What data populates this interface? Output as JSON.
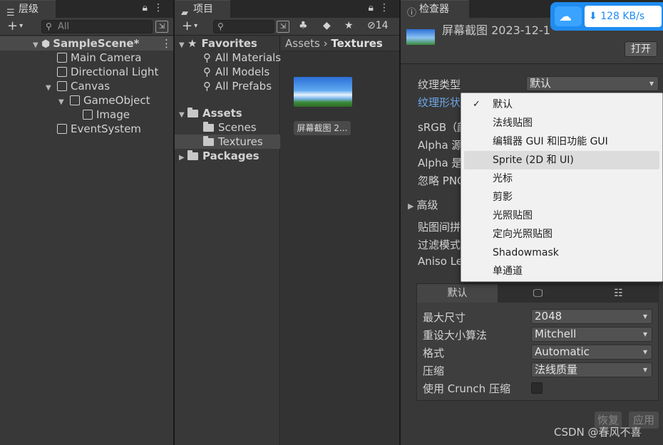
{
  "hierarchy": {
    "tab_label": "层级",
    "search_placeholder": "All",
    "items": [
      {
        "label": "SampleScene*"
      },
      {
        "label": "Main Camera"
      },
      {
        "label": "Directional Light"
      },
      {
        "label": "Canvas"
      },
      {
        "label": "GameObject"
      },
      {
        "label": "Image"
      },
      {
        "label": "EventSystem"
      }
    ]
  },
  "project": {
    "tab_label": "项目",
    "hidden_count": "14",
    "favorites": {
      "label": "Favorites",
      "items": [
        "All Materials",
        "All Models",
        "All Prefabs"
      ]
    },
    "assets": {
      "label": "Assets",
      "items": [
        "Scenes",
        "Textures"
      ]
    },
    "packages": {
      "label": "Packages"
    },
    "breadcrumb": {
      "root": "Assets",
      "current": "Textures"
    },
    "asset_label": "屏幕截图 2..."
  },
  "inspector": {
    "tab_label": "检查器",
    "title": "屏幕截图 2023-12-1",
    "open_button": "打开",
    "props": {
      "texture_type": "纹理类型",
      "texture_type_value": "默认",
      "texture_shape": "纹理形状",
      "srgb": "sRGB（颜",
      "alpha_source": "Alpha 源",
      "alpha_is": "Alpha 是",
      "ignore_png": "忽略 PNG",
      "advanced": "高级",
      "wrap_mode": "贴图间拼",
      "filter_mode": "过滤模式",
      "aniso": "Aniso Le"
    },
    "platform_tabs": {
      "default": "默认"
    },
    "platform_props": [
      {
        "label": "最大尺寸",
        "value": "2048"
      },
      {
        "label": "重设大小算法",
        "value": "Mitchell"
      },
      {
        "label": "格式",
        "value": "Automatic"
      },
      {
        "label": "压缩",
        "value": "法线质量"
      }
    ],
    "crunch_label": "使用 Crunch 压缩",
    "revert_button": "恢复",
    "apply_button": "应用"
  },
  "dropdown_menu": {
    "items": [
      {
        "label": "默认",
        "checked": true
      },
      {
        "label": "法线贴图"
      },
      {
        "label": "编辑器 GUI 和旧功能 GUI"
      },
      {
        "label": "Sprite (2D 和 UI)",
        "hovered": true
      },
      {
        "label": "光标"
      },
      {
        "label": "剪影"
      },
      {
        "label": "光照贴图"
      },
      {
        "label": "定向光照贴图"
      },
      {
        "label": "Shadowmask"
      },
      {
        "label": "单通道"
      }
    ]
  },
  "network_widget": {
    "speed": "128 KB/s"
  },
  "watermark": "CSDN @春风不喜",
  "colors": {
    "accent_link": "#6ea8e8",
    "net_blue": "#1f8cf0"
  }
}
